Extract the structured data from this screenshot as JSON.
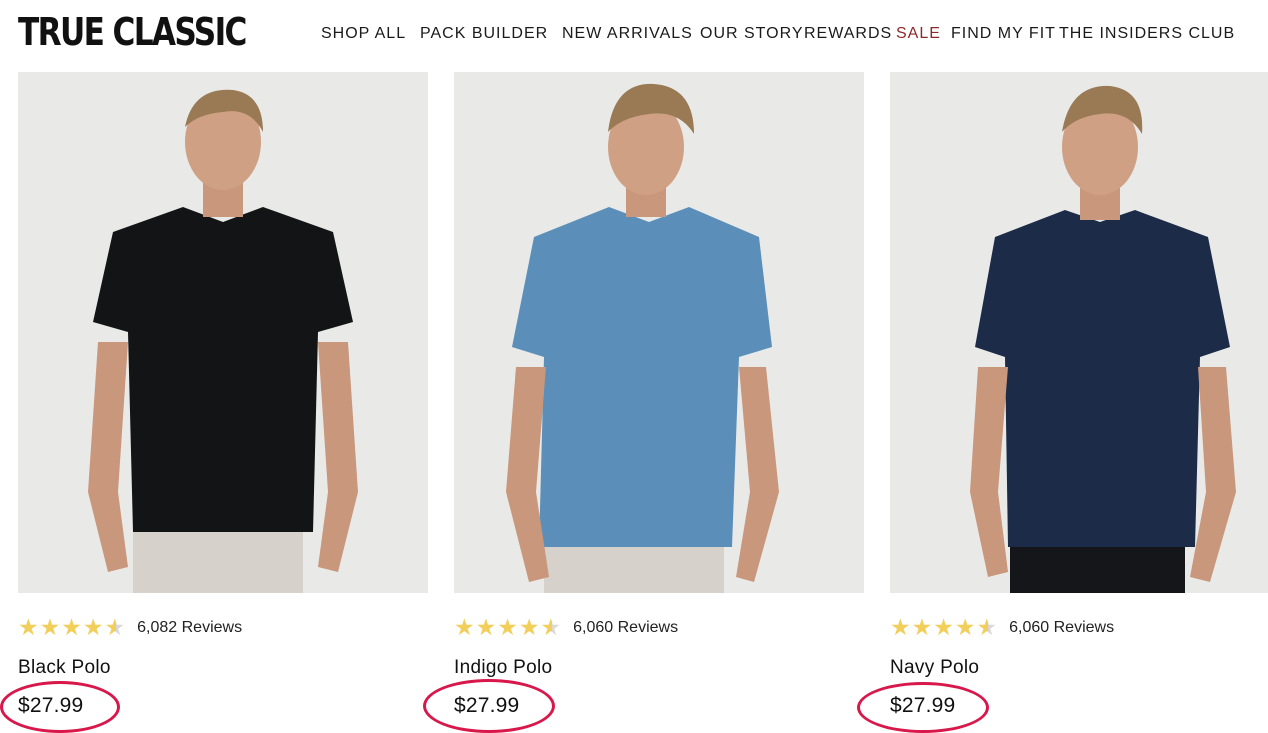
{
  "header": {
    "logo": "TRUE CLASSIC",
    "nav": [
      {
        "label": "SHOP ALL"
      },
      {
        "label": "PACK BUILDER"
      },
      {
        "label": "NEW ARRIVALS"
      },
      {
        "label": "OUR STORY"
      },
      {
        "label": "REWARDS"
      },
      {
        "label": "SALE"
      },
      {
        "label": "FIND MY FIT"
      },
      {
        "label": "THE INSIDERS CLUB"
      }
    ]
  },
  "products": [
    {
      "name": "Black Polo",
      "price": "$27.99",
      "reviews": "6,082 Reviews",
      "rating": 4.5,
      "shirt_color": "#121416"
    },
    {
      "name": "Indigo Polo",
      "price": "$27.99",
      "reviews": "6,060 Reviews",
      "rating": 4.5,
      "shirt_color": "#5b8fb9"
    },
    {
      "name": "Navy Polo",
      "price": "$27.99",
      "reviews": "6,060 Reviews",
      "rating": 4.5,
      "shirt_color": "#1c2c48"
    }
  ],
  "colors": {
    "star": "#f2cf5b",
    "annotation_circle": "#d8174a",
    "sale": "#8b2a2a"
  }
}
